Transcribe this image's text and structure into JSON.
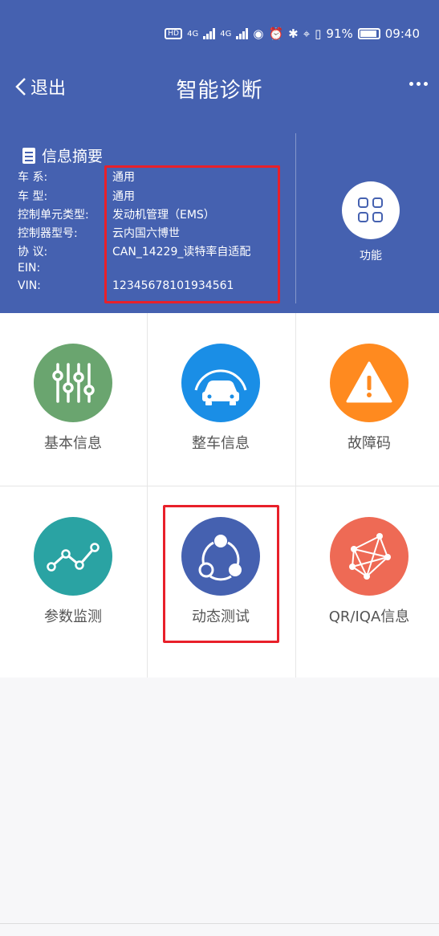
{
  "status_bar": {
    "sim_label": "HD",
    "network1": "4G",
    "network2": "4G",
    "battery_percent": "91%",
    "time": "09:40"
  },
  "header": {
    "back_label": "退出",
    "title": "智能诊断"
  },
  "info": {
    "title": "信息摘要",
    "rows": [
      {
        "label": "车 系:",
        "value": "通用"
      },
      {
        "label": "车 型:",
        "value": "通用"
      },
      {
        "label": "控制单元类型:",
        "value": "发动机管理（EMS）"
      },
      {
        "label": "控制器型号:",
        "value": "云内国六博世"
      },
      {
        "label": "协 议:",
        "value": "CAN_14229_读特率自适配"
      },
      {
        "label": "EIN:",
        "value": ""
      },
      {
        "label": "VIN:",
        "value": "12345678101934561"
      }
    ]
  },
  "function_button": {
    "label": "功能"
  },
  "menu": [
    {
      "label": "基本信息",
      "icon": "sliders-icon",
      "color": "#6aa56f"
    },
    {
      "label": "整车信息",
      "icon": "car-icon",
      "color": "#1a8ee6"
    },
    {
      "label": "故障码",
      "icon": "warning-icon",
      "color": "#ff8a1f"
    },
    {
      "label": "参数监测",
      "icon": "graph-icon",
      "color": "#2aa3a3"
    },
    {
      "label": "动态测试",
      "icon": "share-icon",
      "color": "#4561b0"
    },
    {
      "label": "QR/IQA信息",
      "icon": "network-icon",
      "color": "#ee6a55"
    }
  ],
  "colors": {
    "header_bg": "#4561b0",
    "highlight": "#e8202a"
  }
}
